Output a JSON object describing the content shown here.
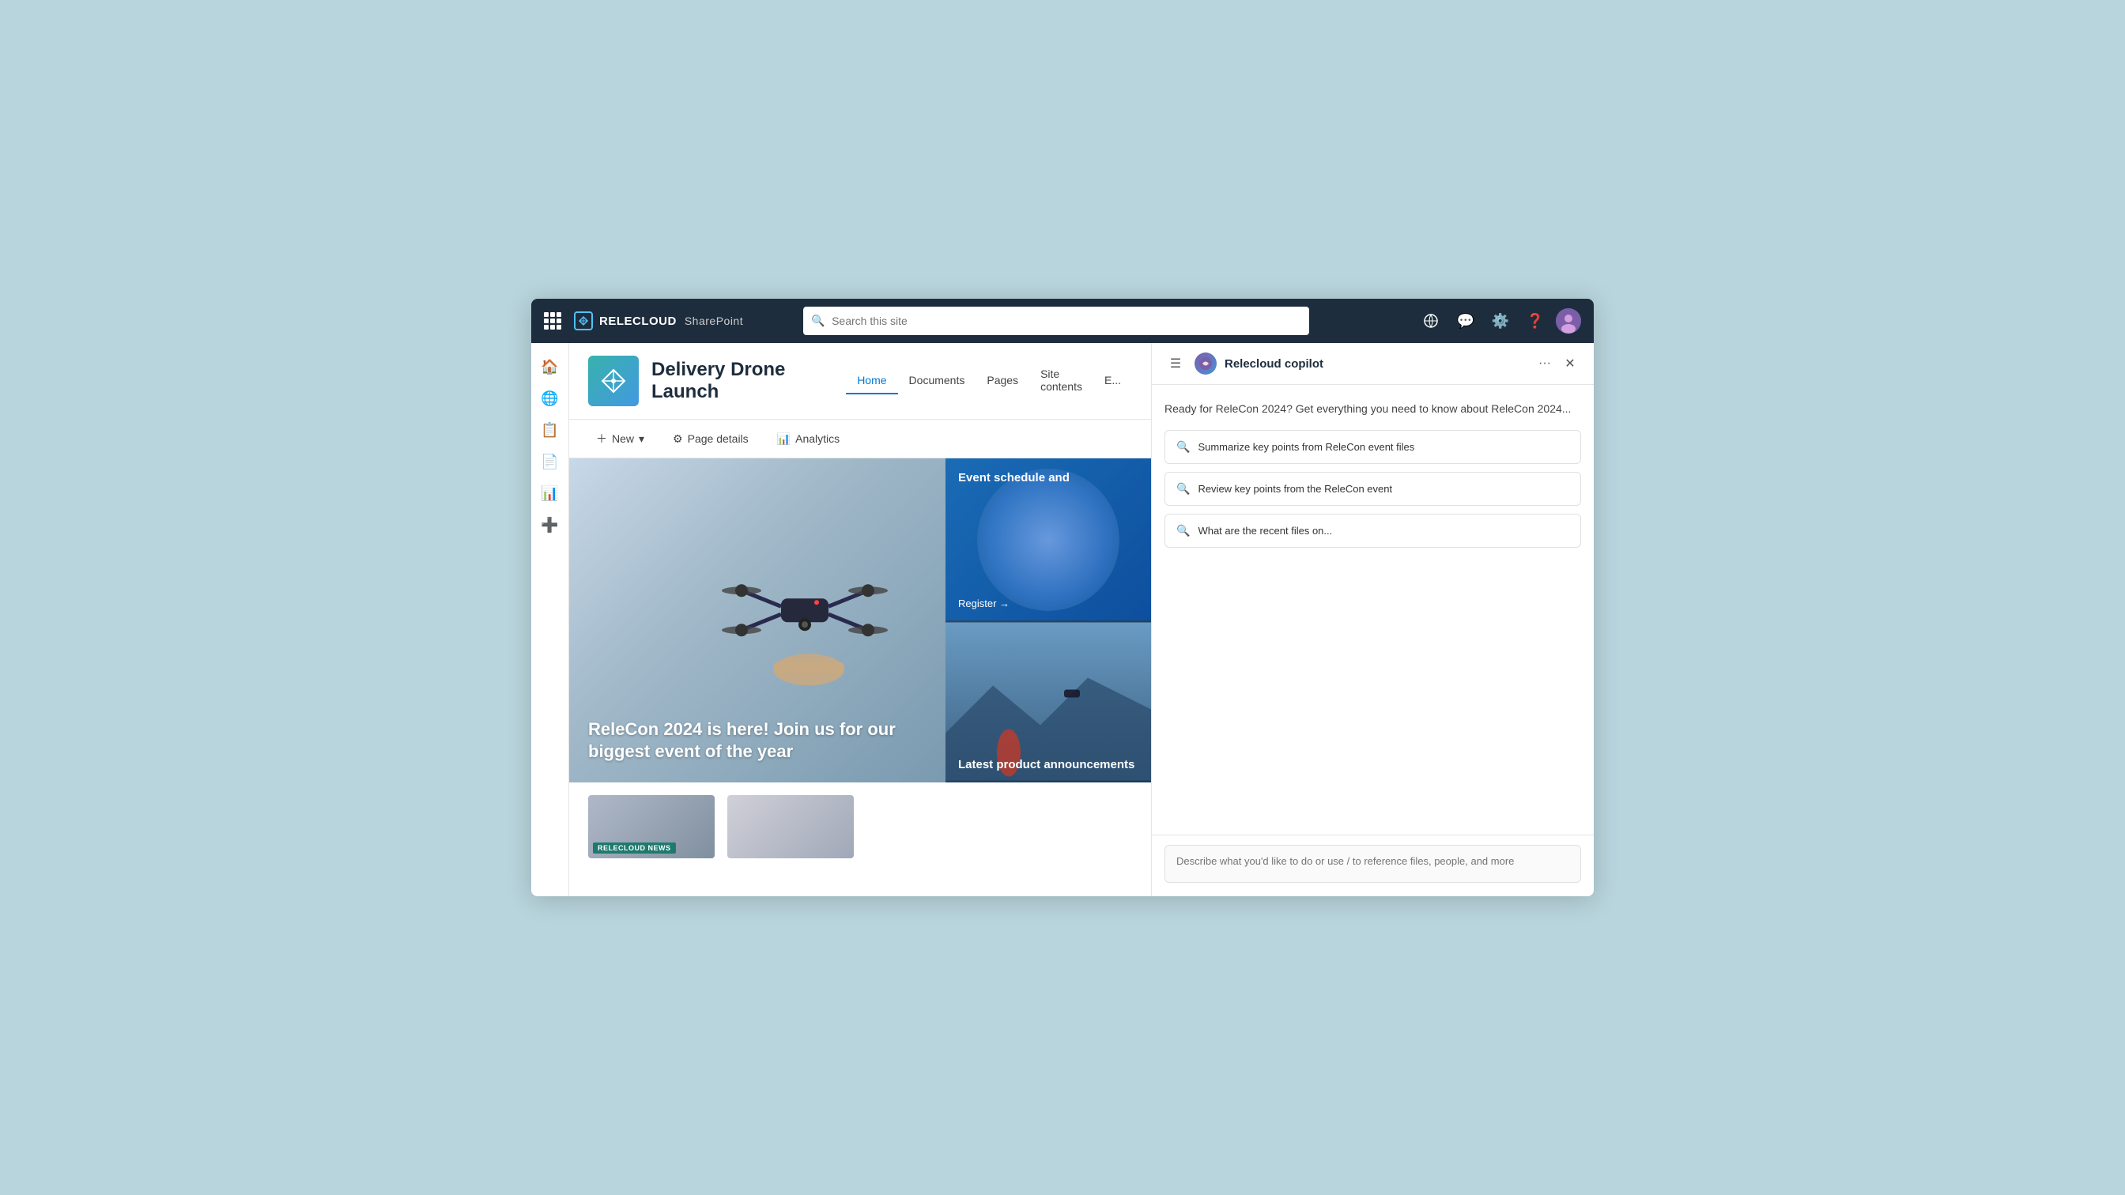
{
  "topbar": {
    "brand": "RELECLOUD",
    "app": "SharePoint",
    "search_placeholder": "Search this site"
  },
  "sidebar": {
    "items": [
      {
        "icon": "🏠",
        "name": "home-icon",
        "label": "Home"
      },
      {
        "icon": "🌐",
        "name": "globe-icon",
        "label": "Sites"
      },
      {
        "icon": "📋",
        "name": "list-icon",
        "label": "Lists"
      },
      {
        "icon": "📄",
        "name": "page-icon",
        "label": "Pages"
      },
      {
        "icon": "📊",
        "name": "table-icon",
        "label": "Tables"
      },
      {
        "icon": "➕",
        "name": "add-icon",
        "label": "Add"
      }
    ]
  },
  "site": {
    "title": "Delivery Drone Launch",
    "nav": [
      {
        "label": "Home",
        "active": true
      },
      {
        "label": "Documents",
        "active": false
      },
      {
        "label": "Pages",
        "active": false
      },
      {
        "label": "Site contents",
        "active": false
      },
      {
        "label": "Edit",
        "active": false
      }
    ],
    "toolbar": {
      "new_label": "New",
      "page_details_label": "Page details",
      "analytics_label": "Analytics"
    }
  },
  "hero": {
    "main_text": "ReleCon 2024 is here! Join us for our biggest event of the year",
    "card_top": {
      "label": "Event schedule and",
      "link": "Register →"
    },
    "card_bottom": {
      "label": "Latest product announcements"
    }
  },
  "news": {
    "badge": "RELECLOUD NEWS"
  },
  "copilot": {
    "title": "Relecloud copilot",
    "intro": "Ready for ReleCon 2024? Get everything you need to know about ReleCon 2024...",
    "suggestions": [
      {
        "text": "Summarize key points from ReleCon event files"
      },
      {
        "text": "Review key points from the ReleCon event"
      },
      {
        "text": "What are the recent files on..."
      }
    ],
    "input_placeholder": "Describe what you'd like to do or use / to reference files, people, and more"
  }
}
